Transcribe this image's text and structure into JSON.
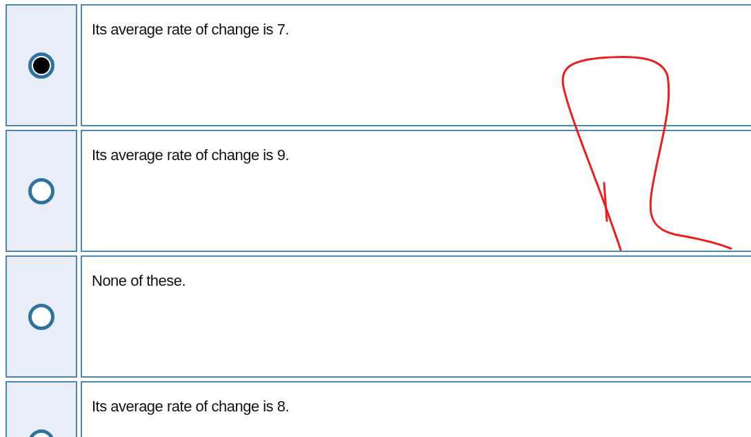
{
  "options": [
    {
      "text": "Its average rate of change is 7.",
      "selected": true
    },
    {
      "text": "Its average rate of change is 9.",
      "selected": false
    },
    {
      "text": "None of these.",
      "selected": false
    },
    {
      "text": "Its average rate of change is 8.",
      "selected": false
    }
  ]
}
